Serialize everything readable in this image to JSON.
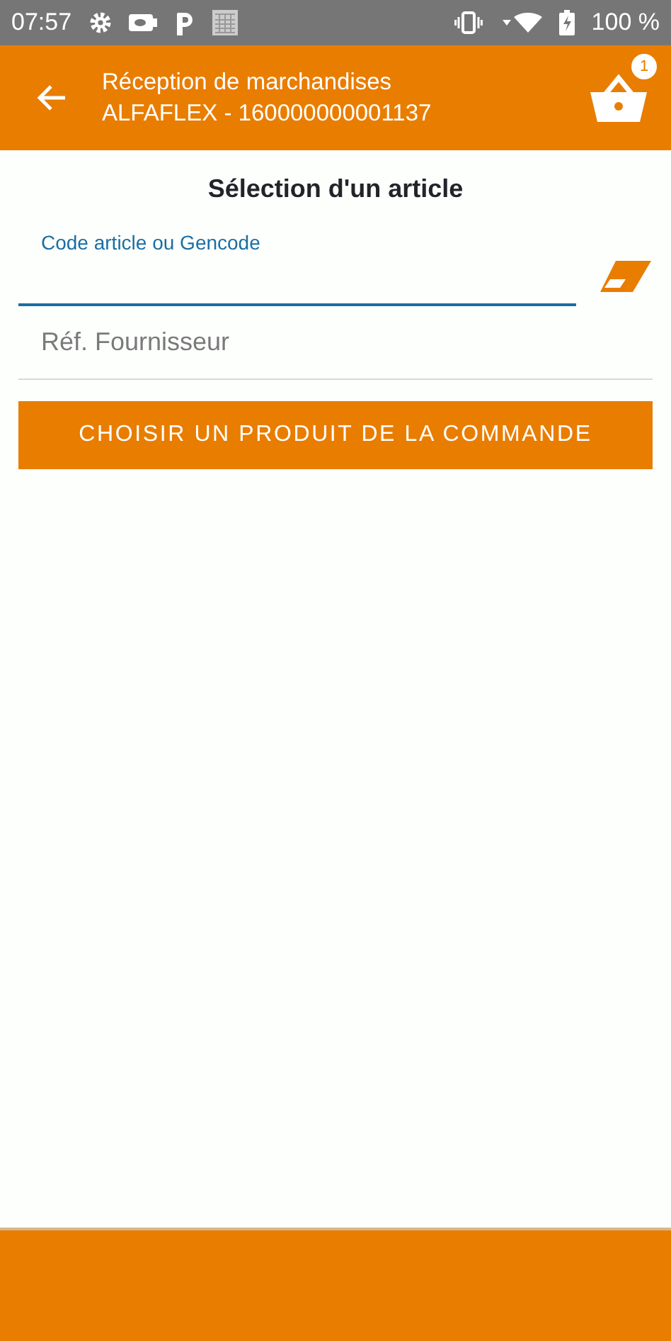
{
  "status_bar": {
    "time": "07:57",
    "battery": "100 %"
  },
  "app_bar": {
    "title": "Réception de marchandises",
    "subtitle": "ALFAFLEX - 160000000001137",
    "cart_badge": "1"
  },
  "heading": "Sélection d'un article",
  "fields": [
    {
      "label": "Code article ou Gencode",
      "focused": true
    },
    {
      "placeholder": "Réf. Fournisseur",
      "focused": false
    }
  ],
  "button": "CHOISIR UN PRODUIT DE LA COMMANDE"
}
